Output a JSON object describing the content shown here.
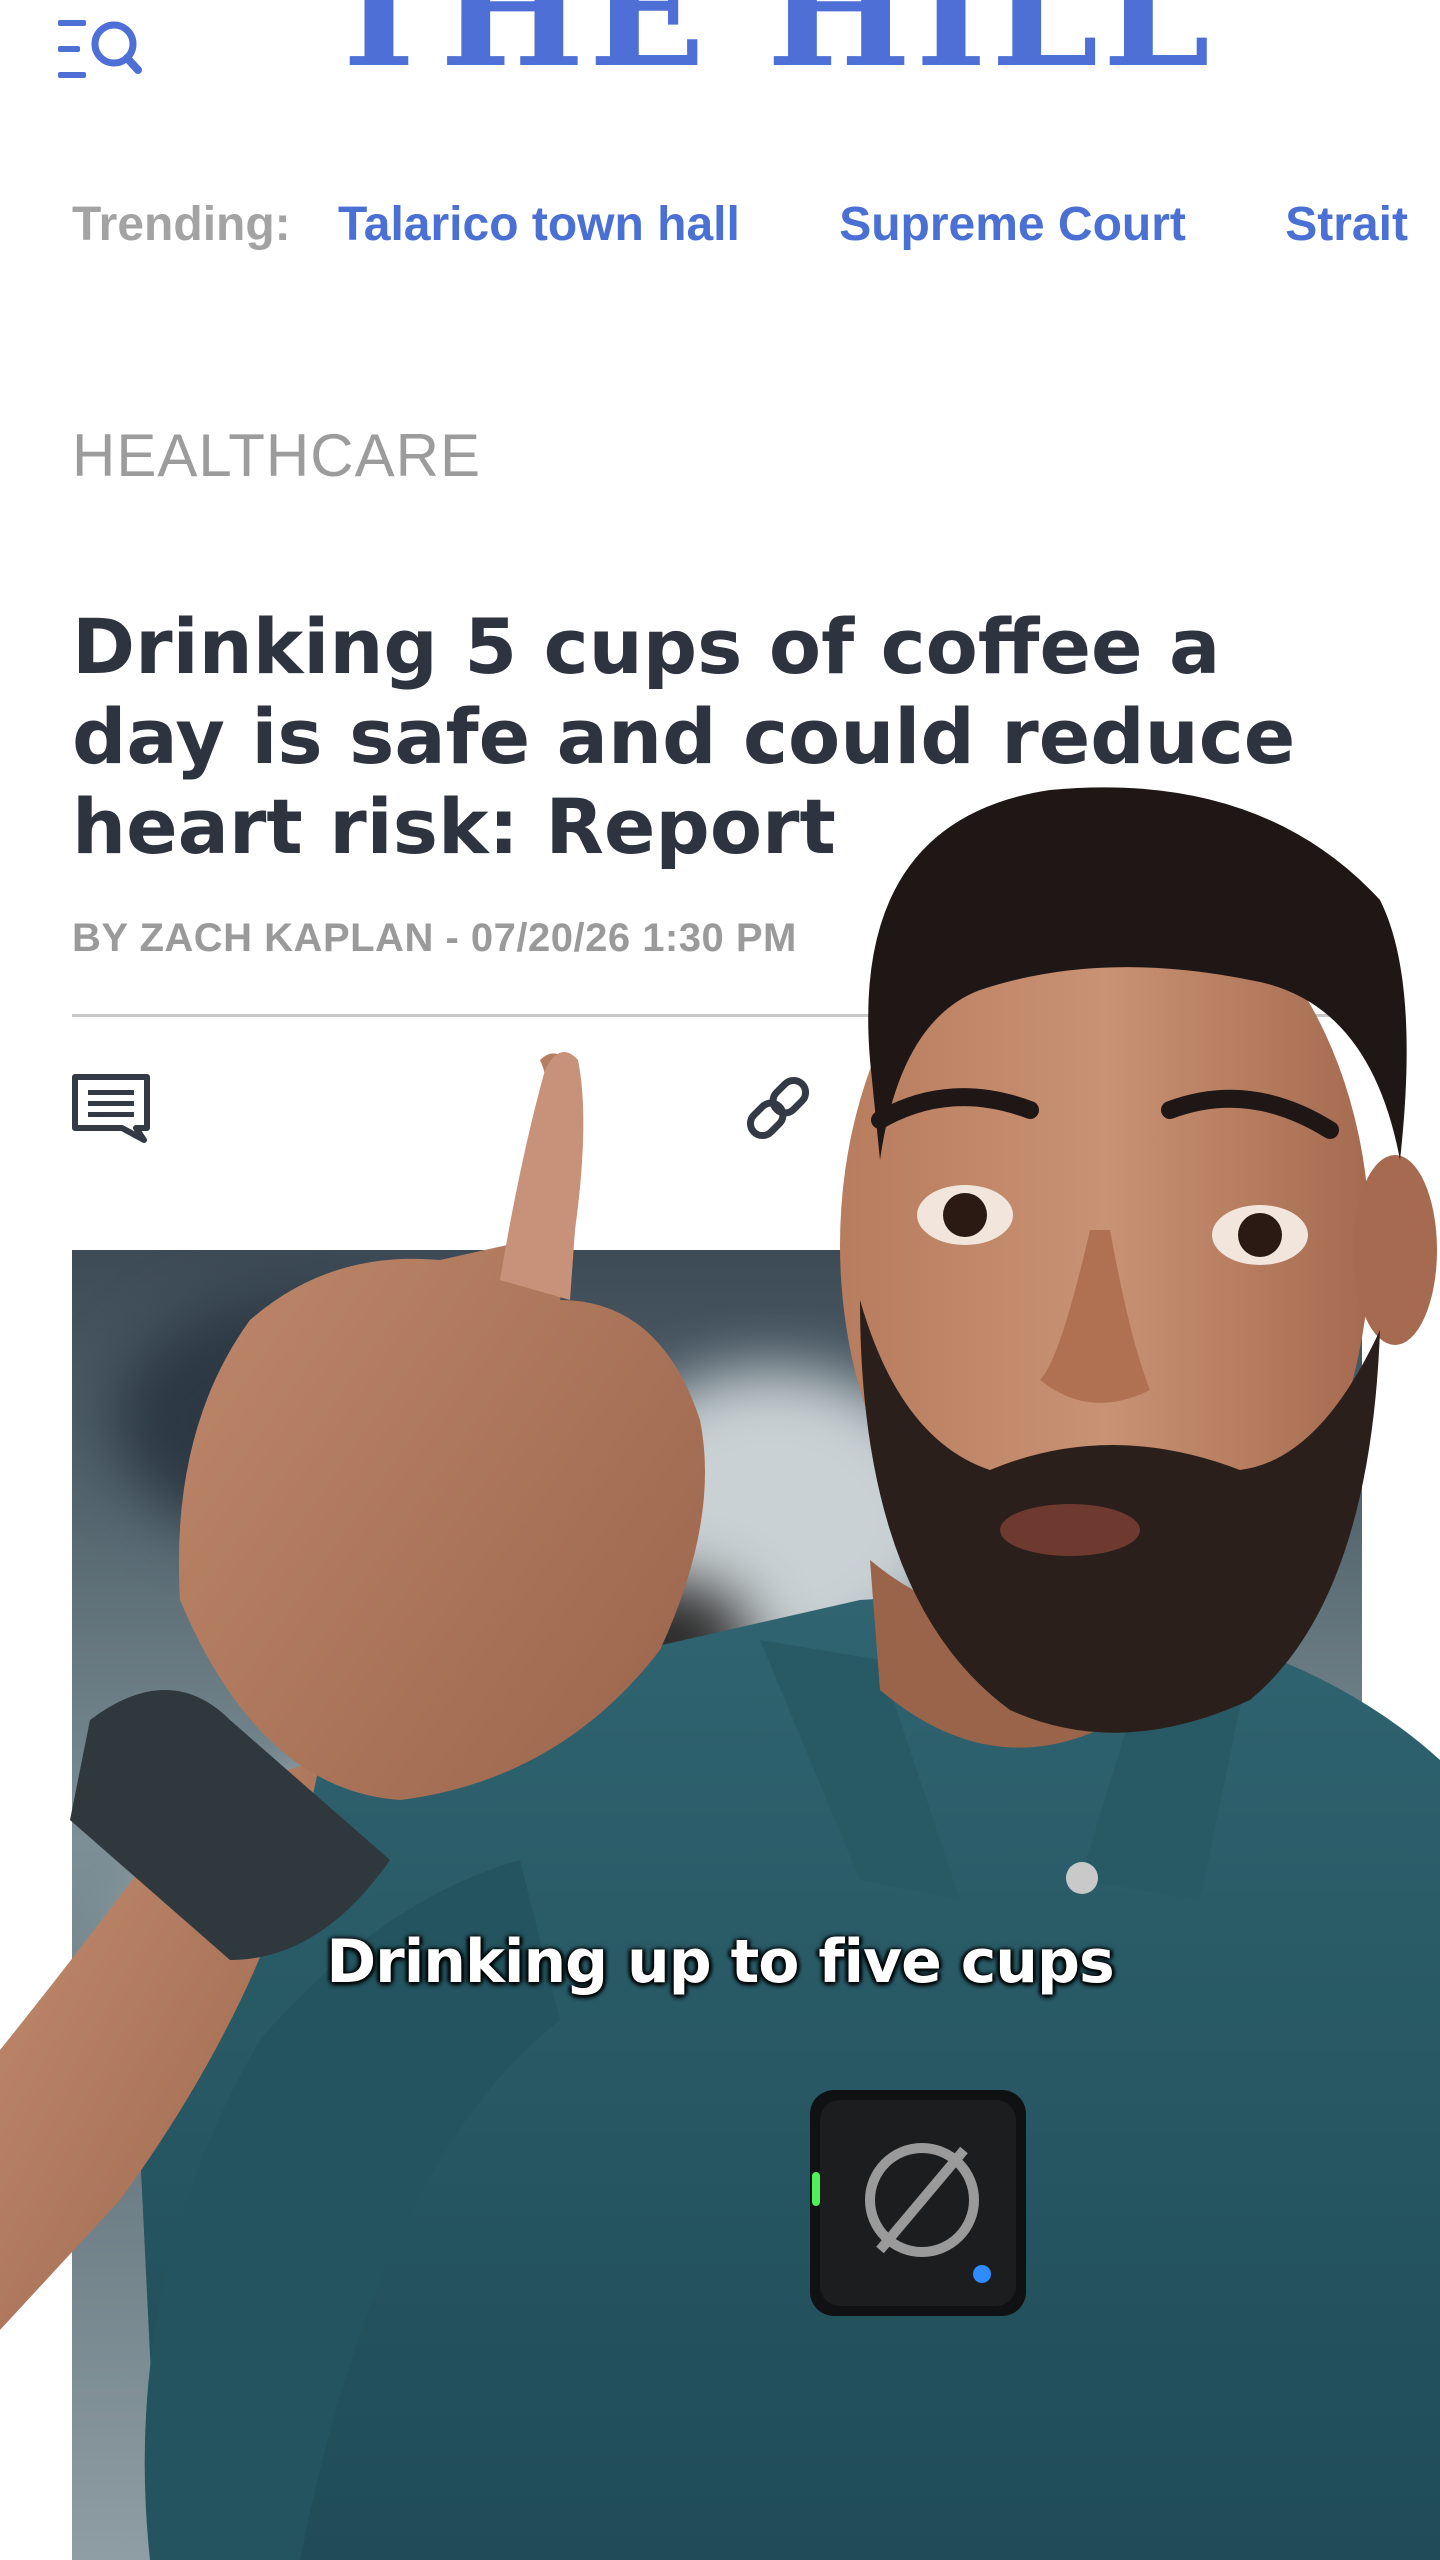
{
  "header": {
    "logo_text": "THE HILL",
    "menu_icon": "menu-search-icon",
    "brand_color": "#4d6fd6"
  },
  "trending": {
    "label": "Trending:",
    "links": [
      "Talarico town hall",
      "Supreme Court",
      "Strait"
    ]
  },
  "article": {
    "section": "HEALTHCARE",
    "headline": "Drinking 5 cups of coffee a day is safe and could reduce heart risk: Report",
    "byline": "BY ZACH KAPLAN - 07/20/26 1:30 PM",
    "share_icons": [
      "comment-icon",
      "link-icon"
    ]
  },
  "video": {
    "caption": "Drinking up to five cups"
  }
}
